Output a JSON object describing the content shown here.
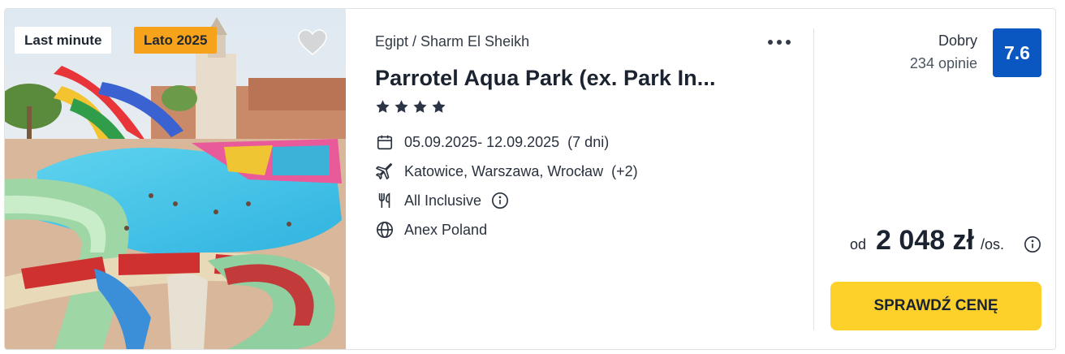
{
  "badges": {
    "last_minute": "Last minute",
    "season": "Lato 2025"
  },
  "location": {
    "breadcrumb": "Egipt / Sharm El Sheikh"
  },
  "hotel": {
    "name": "Parrotel Aqua Park (ex. Park In...",
    "stars": 4
  },
  "details": {
    "dates": "05.09.2025- 12.09.2025",
    "duration": "(7 dni)",
    "airports": "Katowice, Warszawa, Wrocław",
    "airports_extra": "(+2)",
    "board": "All Inclusive",
    "operator": "Anex Poland"
  },
  "rating": {
    "label": "Dobry",
    "reviews": "234 opinie",
    "score": "7.6"
  },
  "price": {
    "prefix": "od",
    "amount": "2 048 zł",
    "unit": "/os."
  },
  "cta": {
    "label": "SPRAWDŹ CENĘ"
  },
  "icons": {
    "favorite": "heart-icon",
    "more": "more-options-icon",
    "date": "calendar-icon",
    "flight": "plane-icon",
    "board": "cutlery-icon",
    "operator": "globe-icon",
    "info": "info-icon"
  },
  "colors": {
    "season_badge": "#f7a21b",
    "score_bg": "#0a57c2",
    "cta_bg": "#fdd12a",
    "star": "#2b3546"
  }
}
